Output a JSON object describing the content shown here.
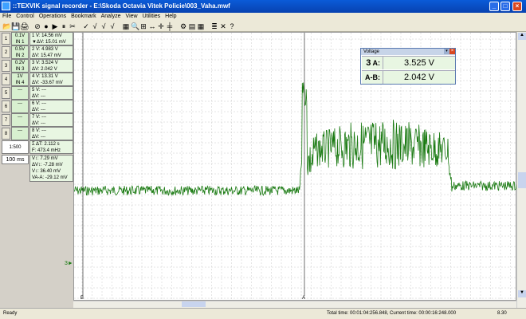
{
  "window": {
    "title": "::TEXVIK signal recorder - E:\\Skoda Octavia Vitek Policie\\003_Vaha.mwf",
    "min": "_",
    "max": "□",
    "close": "×"
  },
  "menu": [
    "File",
    "Control",
    "Operations",
    "Bookmark",
    "Analyze",
    "View",
    "Utilities",
    "Help"
  ],
  "toolbar": [
    {
      "icon": "open-icon",
      "glyph": "📂"
    },
    {
      "icon": "save-icon",
      "glyph": "💾"
    },
    {
      "icon": "print-icon",
      "glyph": "🖨"
    },
    {
      "icon": "stop-icon",
      "glyph": "⊘"
    },
    {
      "icon": "record-icon",
      "glyph": "●"
    },
    {
      "icon": "play-icon",
      "glyph": "▶"
    },
    {
      "icon": "pause-icon",
      "glyph": "⏸"
    },
    {
      "icon": "cut-icon",
      "glyph": "✂"
    },
    {
      "icon": "check-icon",
      "glyph": "✓"
    },
    {
      "icon": "check2-icon",
      "glyph": "√"
    },
    {
      "icon": "check3-icon",
      "glyph": "√"
    },
    {
      "icon": "check4-icon",
      "glyph": "√"
    },
    {
      "icon": "chart-icon",
      "glyph": "▦"
    },
    {
      "icon": "zoom-icon",
      "glyph": "🔍"
    },
    {
      "icon": "zoom-fit-icon",
      "glyph": "⊞"
    },
    {
      "icon": "arrows-icon",
      "glyph": "↔"
    },
    {
      "icon": "cursor-icon",
      "glyph": "✛"
    },
    {
      "icon": "marker-icon",
      "glyph": "╪"
    },
    {
      "icon": "settings-icon",
      "glyph": "⚙"
    },
    {
      "icon": "grid-icon",
      "glyph": "▤"
    },
    {
      "icon": "table-icon",
      "glyph": "▦"
    },
    {
      "icon": "list-icon",
      "glyph": "≣"
    },
    {
      "icon": "delete-icon",
      "glyph": "✕"
    },
    {
      "icon": "help-icon",
      "glyph": "?"
    }
  ],
  "channels": [
    {
      "btn": "1",
      "range": "0.1V",
      "input": "IN 1",
      "l1": "1  V: 14.56 mV",
      "l2": "▼ΔV: 15.01 mV"
    },
    {
      "btn": "2",
      "range": "0.5V",
      "input": "IN 2",
      "l1": "2  V: 4.983 V",
      "l2": "  ΔV: 15.47 mV"
    },
    {
      "btn": "3",
      "range": "0.2V",
      "input": "IN 3",
      "l1": "3  V: 3.524 V",
      "l2": "  ΔV: 2.042 V"
    },
    {
      "btn": "4",
      "range": "1V",
      "input": "IN 4",
      "l1": "4  V: 13.31 V",
      "l2": "  ΔV: -33.67 mV"
    },
    {
      "btn": "5",
      "range": "---",
      "input": "",
      "l1": "5  V: ---",
      "l2": "  ΔV: ---"
    },
    {
      "btn": "6",
      "range": "---",
      "input": "",
      "l1": "6  V: ---",
      "l2": "  ΔV: ---"
    },
    {
      "btn": "7",
      "range": "---",
      "input": "",
      "l1": "7  V: ---",
      "l2": "  ΔV: ---"
    },
    {
      "btn": "8",
      "range": "---",
      "input": "",
      "l1": "8  V: ---",
      "l2": "  ΔV: ---"
    }
  ],
  "timebase": {
    "ratio": "1:500",
    "zoom": "100 ms",
    "l1": "Σ  ΔT: 2.112 s",
    "l2": "   F: 473.4 mHz"
  },
  "measure": {
    "l1": "V↕: 7.29 mV",
    "l2": "ΔV↕: -7.28 mV",
    "l3": "V↕: 36.40 mV",
    "l4": "V<sub>B</sub>-V<sub>A</sub>: -29.12 mV",
    "l4text": "VA-A: -29.12 mV"
  },
  "voltage_panel": {
    "title": "Voltage",
    "channel": "3",
    "a_label": "A:",
    "a_value": "3.525 V",
    "ab_label": "A-B:",
    "ab_value": "2.042 V"
  },
  "marker_label": "3►",
  "cursor_a": "A",
  "cursor_b": "B",
  "status": {
    "left": "Ready",
    "total": "Total time: 00:01:04:256.848, Current time: 00:00:16:248.000",
    "value": "8.30"
  },
  "colors": {
    "signal": "#1a7a12",
    "grid": "#c8c8c8",
    "accent": "#0a5bd8"
  }
}
